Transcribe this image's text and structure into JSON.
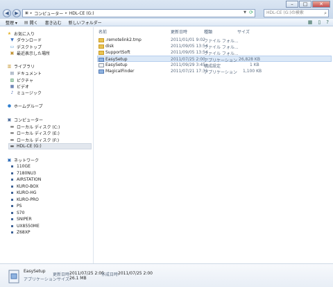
{
  "window": {
    "minimize_glyph": "–",
    "maximize_glyph": "□",
    "close_glyph": "✕"
  },
  "address": {
    "segments": [
      "コンピューター",
      "HDL-CE (G:)"
    ],
    "separator": "▸"
  },
  "search": {
    "placeholder": "HDL-CE (G:)の検索"
  },
  "toolbar": {
    "organize": "整理 ▾",
    "open": "開く",
    "burn": "書き込む",
    "new_folder": "新しいフォルダー"
  },
  "sidebar": {
    "favorites": {
      "header": "お気に入り",
      "items": [
        "ダウンロード",
        "デスクトップ",
        "最近表示した場所"
      ]
    },
    "libraries": {
      "header": "ライブラリ",
      "items": [
        "ドキュメント",
        "ピクチャ",
        "ビデオ",
        "ミュージック"
      ]
    },
    "homegroup": "ホームグループ",
    "computer": {
      "header": "コンピューター",
      "items": [
        "ローカル ディスク (C:)",
        "ローカル ディスク (E:)",
        "ローカル ディスク (F:)",
        "HDL-CE (G:)"
      ]
    },
    "network": {
      "header": "ネットワーク",
      "items": [
        "110GE",
        "7180NU3",
        "AIRSTATION",
        "KURO-BOX",
        "KURO-HG",
        "KURO-PRO",
        "PS",
        "S70",
        "SNIPER",
        "UX8550ME",
        "Z68XP"
      ]
    }
  },
  "columns": {
    "name": "名前",
    "date": "更新日時",
    "type": "種類",
    "size": "サイズ"
  },
  "files": [
    {
      "name": ".remotelink2.tmp",
      "date": "2011/01/01 9:02",
      "type": "ファイル フォル...",
      "size": "",
      "icon": "folder"
    },
    {
      "name": "disk",
      "date": "2011/09/05 13:54",
      "type": "ファイル フォル...",
      "size": "",
      "icon": "folder"
    },
    {
      "name": "SupportSoft",
      "date": "2011/09/05 13:54",
      "type": "ファイル フォル...",
      "size": "",
      "icon": "folder"
    },
    {
      "name": "EasySetup",
      "date": "2011/07/25 2:00",
      "type": "アプリケーション",
      "size": "26,828 KB",
      "icon": "app"
    },
    {
      "name": "EasySetup",
      "date": "2011/09/29 3:45",
      "type": "構成設定",
      "size": "1 KB",
      "icon": "config"
    },
    {
      "name": "MagicalFinder",
      "date": "2011/07/21 17:31",
      "type": "アプリケーション",
      "size": "1,100 KB",
      "icon": "app"
    }
  ],
  "details": {
    "name": "EasySetup",
    "modified_label": "更新日時:",
    "modified_value": "2011/07/25 2:00",
    "created_label": "作成日時:",
    "created_value": "2011/07/25 2:00",
    "type_value": "アプリケーション",
    "size_label": "サイズ:",
    "size_value": "26.1 MB"
  }
}
